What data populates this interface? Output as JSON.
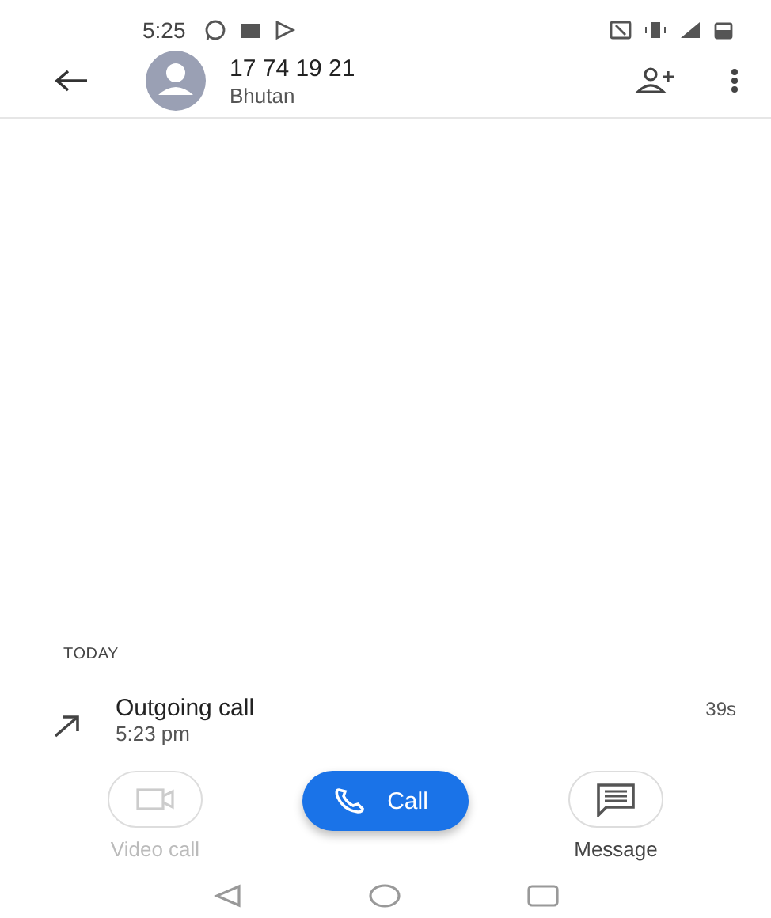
{
  "status_bar": {
    "time": "5:25"
  },
  "header": {
    "number": "17 74 19 21",
    "location": "Bhutan"
  },
  "history": {
    "section": "TODAY",
    "calls": [
      {
        "kind": "outgoing",
        "label": "Outgoing call",
        "time": "5:23 pm",
        "duration": "39s"
      }
    ]
  },
  "actions": [
    {
      "kind": "video",
      "label": "Video call",
      "disabled": true
    },
    {
      "kind": "call",
      "label": "Call",
      "disabled": false
    },
    {
      "kind": "message",
      "label": "Message",
      "disabled": false
    }
  ]
}
